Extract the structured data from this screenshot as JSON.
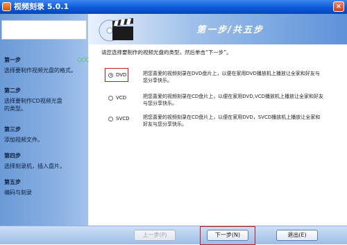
{
  "window": {
    "title": "视频刻录 5.0.1",
    "close_label": "×"
  },
  "header": {
    "title": "第一步/共五步"
  },
  "sidebar": {
    "steps": [
      {
        "name": "第一步",
        "desc": "选择要制作视频光盘的格式。"
      },
      {
        "name": "第二步",
        "desc": "选择要制作CD视频光盘的类型。"
      },
      {
        "name": "第三步",
        "desc": "添加视频文件。"
      },
      {
        "name": "第四步",
        "desc": "选择刻录机，插入盘片。"
      },
      {
        "name": "第五步",
        "desc": "编码与刻录"
      }
    ],
    "active_indicator": "○○○"
  },
  "content": {
    "instruction": "请您选择要制作的视频光盘的类型，然后单击“下一步”。",
    "options": [
      {
        "label": "DVD",
        "checked": true,
        "desc": "把您喜爱的视频刻录在DVD盘片上，以便在家用DVD播放机上播放让全家和好友与您分享快乐。"
      },
      {
        "label": "VCD",
        "checked": false,
        "desc": "把您喜爱的视频刻录在CD盘片上，以便在家用DVD,VCD播放机上播放让全家和好友与您分享快乐。"
      },
      {
        "label": "SVCD",
        "checked": false,
        "desc": "把您喜爱的视频刻录在CD盘片上，以便在家用DVD，SVCD播放机上播放让全家和好友与您分享快乐。"
      }
    ]
  },
  "footer": {
    "prev_label": "上一步(P)",
    "next_label": "下一步(N)",
    "exit_label": "退出(E)"
  },
  "colors": {
    "titlebar": "#0a56d8",
    "highlight": "#c11a1a",
    "sidebar": "#8db3e4"
  }
}
